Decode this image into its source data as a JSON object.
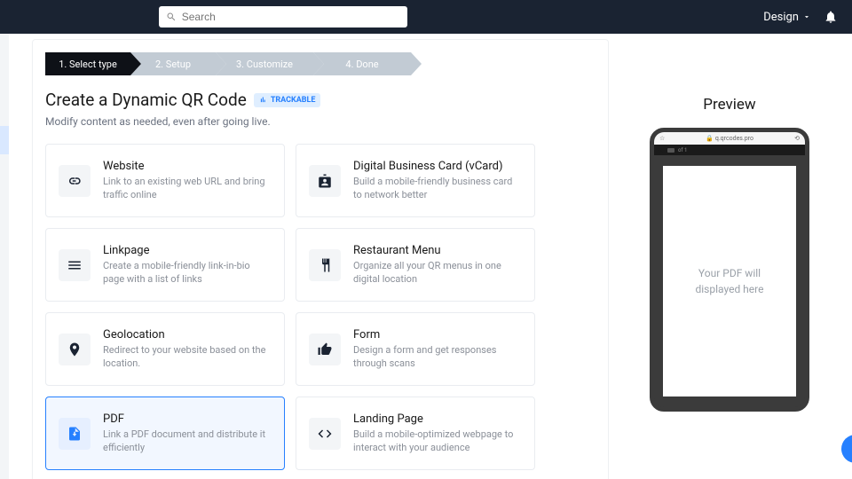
{
  "topbar": {
    "search_placeholder": "Search",
    "design_label": "Design"
  },
  "steps": [
    {
      "label": "1. Select type",
      "active": true
    },
    {
      "label": "2. Setup",
      "active": false
    },
    {
      "label": "3. Customize",
      "active": false
    },
    {
      "label": "4. Done",
      "active": false
    }
  ],
  "page_title": "Create a Dynamic QR Code",
  "trackable_badge": "TRACKABLE",
  "page_subtitle": "Modify content as needed, even after going live.",
  "tiles": [
    {
      "title": "Website",
      "desc": "Link to an existing web URL and bring traffic online"
    },
    {
      "title": "Digital Business Card (vCard)",
      "desc": "Build a mobile-friendly business card to network better"
    },
    {
      "title": "Linkpage",
      "desc": "Create a mobile-friendly link-in-bio page with a list of links"
    },
    {
      "title": "Restaurant Menu",
      "desc": "Organize all your QR menus in one digital location"
    },
    {
      "title": "Geolocation",
      "desc": "Redirect to your website based on the location."
    },
    {
      "title": "Form",
      "desc": "Design a form and get responses through scans"
    },
    {
      "title": "PDF",
      "desc": "Link a PDF document and distribute it efficiently"
    },
    {
      "title": "Landing Page",
      "desc": "Build a mobile-optimized webpage to interact with your audience"
    }
  ],
  "preview": {
    "title": "Preview",
    "url": "q.qrcodes.pro",
    "pagecount": "of 1",
    "screen_text": "Your PDF will displayed here"
  }
}
